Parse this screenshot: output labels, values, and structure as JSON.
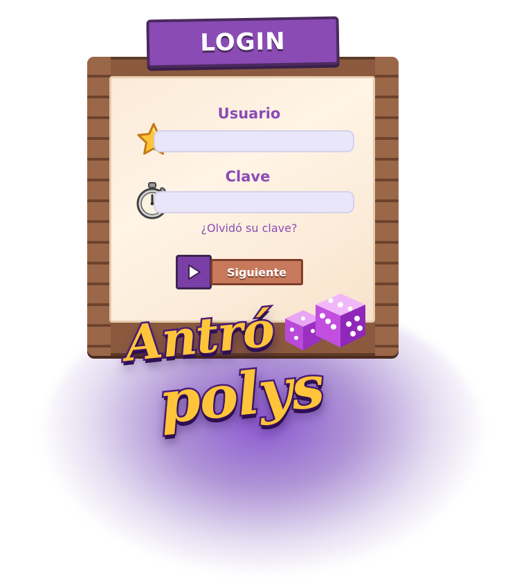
{
  "title": "LOGIN",
  "form": {
    "username_label": "Usuario",
    "username_value": "",
    "password_label": "Clave",
    "password_value": "",
    "forgot_link": "¿Olvidó su clave?",
    "submit_label": "Siguiente"
  },
  "logo": {
    "line1": "Antró",
    "line2": "polys"
  },
  "icons": {
    "username": "star-icon",
    "password": "stopwatch-icon",
    "submit": "play-icon",
    "logo_decoration": "dice-icon"
  },
  "colors": {
    "accent_purple": "#8a4bb5",
    "logo_yellow": "#ffc43a",
    "wood": "#8b5a3e",
    "button_orange": "#c7795c",
    "field_bg": "#e8e6f8"
  }
}
